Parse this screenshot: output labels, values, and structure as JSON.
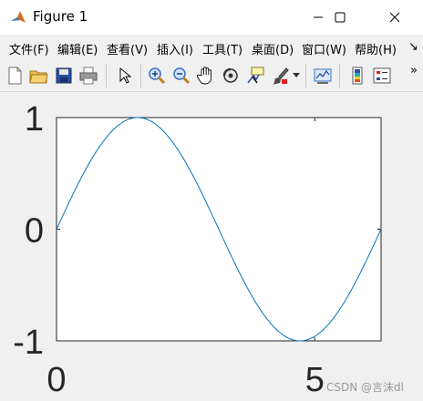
{
  "window": {
    "title": "Figure 1",
    "controls": [
      "minimize",
      "maximize",
      "close"
    ]
  },
  "menu": {
    "items": [
      "文件(F)",
      "编辑(E)",
      "查看(V)",
      "插入(I)",
      "工具(T)",
      "桌面(D)",
      "窗口(W)",
      "帮助(H)"
    ],
    "overflow": "↘"
  },
  "toolbar": {
    "buttons": [
      "new-figure-icon",
      "open-icon",
      "save-icon",
      "print-icon",
      "pointer-icon",
      "zoom-in-icon",
      "zoom-out-icon",
      "pan-icon",
      "rotate-icon",
      "data-cursor-icon",
      "brush-icon",
      "link-plot-icon",
      "colorbar-icon",
      "legend-icon"
    ],
    "overflow": "»"
  },
  "chart_data": {
    "type": "line",
    "function": "sin(x)",
    "x": [
      0,
      0.5,
      1,
      1.5,
      2,
      2.5,
      3,
      3.5,
      4,
      4.5,
      5,
      5.5,
      6,
      6.2832
    ],
    "y": [
      0,
      0.479,
      0.841,
      0.997,
      0.909,
      0.598,
      0.141,
      -0.351,
      -0.757,
      -0.978,
      -0.959,
      -0.706,
      -0.279,
      0
    ],
    "xlim": [
      0,
      6.2832
    ],
    "ylim": [
      -1,
      1
    ],
    "xticks": [
      0,
      5
    ],
    "xtick_labels": [
      "0",
      "5"
    ],
    "yticks": [
      1,
      0,
      -1
    ],
    "ytick_labels": [
      "1",
      "0",
      "-1"
    ],
    "title": "",
    "xlabel": "",
    "ylabel": "",
    "grid": false,
    "line_color": "#0072bd"
  },
  "watermark": "CSDN @言沫dl"
}
